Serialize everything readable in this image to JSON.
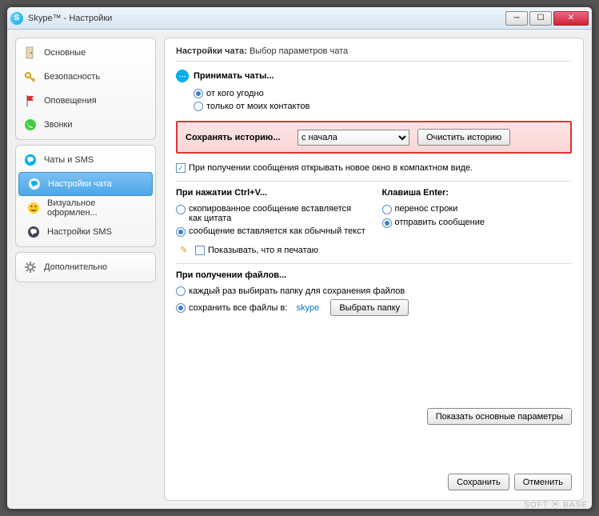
{
  "window": {
    "title": "Skype™ - Настройки"
  },
  "sidebar": {
    "groups": [
      {
        "items": [
          {
            "label": "Основные",
            "icon": "door-icon"
          },
          {
            "label": "Безопасность",
            "icon": "key-icon"
          },
          {
            "label": "Оповещения",
            "icon": "flag-icon"
          },
          {
            "label": "Звонки",
            "icon": "phone-icon"
          }
        ]
      },
      {
        "items": [
          {
            "label": "Чаты и SMS",
            "icon": "chat-icon",
            "sub": false
          },
          {
            "label": "Настройки чата",
            "icon": "chat-settings-icon",
            "selected": true,
            "sub": true
          },
          {
            "label": "Визуальное оформлен...",
            "icon": "smiley-icon",
            "sub": true
          },
          {
            "label": "Настройки SMS",
            "icon": "sms-icon",
            "sub": true
          }
        ]
      },
      {
        "items": [
          {
            "label": "Дополнительно",
            "icon": "gear-icon"
          }
        ]
      }
    ]
  },
  "panel": {
    "header_bold": "Настройки чата:",
    "header_rest": "Выбор параметров чата",
    "accept": {
      "title": "Принимать чаты...",
      "opt_anyone": "от кого угодно",
      "opt_contacts": "только от моих контактов",
      "selected": "anyone"
    },
    "history": {
      "label": "Сохранять историю...",
      "dropdown_value": "с начала",
      "options": [
        "с начала"
      ],
      "clear_btn": "Очистить историю"
    },
    "compact_check": {
      "label": "При получении сообщения открывать новое окно в компактном виде.",
      "checked": true
    },
    "paste": {
      "title": "При нажатии Ctrl+V...",
      "opt_quote": "скопированное сообщение вставляется как цитата",
      "opt_plain": "сообщение вставляется как обычный текст",
      "selected": "plain"
    },
    "enter": {
      "title": "Клавиша Enter:",
      "opt_newline": "перенос строки",
      "opt_send": "отправить сообщение",
      "selected": "send"
    },
    "typing": {
      "label": "Показывать, что я печатаю",
      "checked": false
    },
    "files": {
      "title": "При получении файлов...",
      "opt_ask": "каждый раз выбирать папку для сохранения файлов",
      "opt_save": "сохранить все файлы в:",
      "selected": "save",
      "folder": "skype",
      "browse_btn": "Выбрать папку"
    },
    "show_basic_btn": "Показать основные параметры",
    "save_btn": "Сохранить",
    "cancel_btn": "Отменить"
  },
  "watermark": "SOFT ⦿ BASE"
}
